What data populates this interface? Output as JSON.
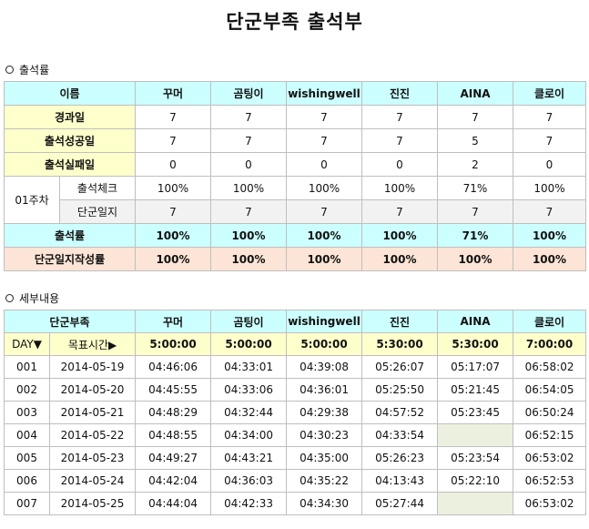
{
  "title": "단군부족 출석부",
  "section1": {
    "heading": "출석률",
    "header": [
      "이름",
      "꾸머",
      "곰팅이",
      "wishingwell",
      "진진",
      "AINA",
      "클로이"
    ],
    "rows": [
      {
        "label": "경과일",
        "values": [
          "7",
          "7",
          "7",
          "7",
          "7",
          "7"
        ]
      },
      {
        "label": "출석성공일",
        "values": [
          "7",
          "7",
          "7",
          "7",
          "5",
          "7"
        ]
      },
      {
        "label": "출석실패일",
        "values": [
          "0",
          "0",
          "0",
          "0",
          "2",
          "0"
        ]
      }
    ],
    "week_label": "01주차",
    "week_rows": [
      {
        "label": "출석체크",
        "values": [
          "100%",
          "100%",
          "100%",
          "100%",
          "71%",
          "100%"
        ]
      },
      {
        "label": "단군일지",
        "values": [
          "7",
          "7",
          "7",
          "7",
          "7",
          "7"
        ]
      }
    ],
    "rate_row": {
      "label": "출석률",
      "values": [
        "100%",
        "100%",
        "100%",
        "100%",
        "71%",
        "100%"
      ]
    },
    "journal_row": {
      "label": "단군일지작성률",
      "values": [
        "100%",
        "100%",
        "100%",
        "100%",
        "100%",
        "100%"
      ]
    }
  },
  "section2": {
    "heading": "세부내용",
    "header": [
      "단군부족",
      "꾸머",
      "곰팅이",
      "wishingwell",
      "진진",
      "AINA",
      "클로이"
    ],
    "day_label": "DAY▼",
    "target_label": "목표시간▶",
    "targets": [
      "5:00:00",
      "5:00:00",
      "5:00:00",
      "5:30:00",
      "5:30:00",
      "7:00:00"
    ],
    "rows": [
      {
        "day": "001",
        "date": "2014-05-19",
        "times": [
          "04:46:06",
          "04:33:01",
          "04:39:08",
          "05:26:07",
          "05:17:07",
          "06:58:02"
        ]
      },
      {
        "day": "002",
        "date": "2014-05-20",
        "times": [
          "04:45:55",
          "04:33:06",
          "04:36:01",
          "05:25:50",
          "05:21:45",
          "06:54:05"
        ]
      },
      {
        "day": "003",
        "date": "2014-05-21",
        "times": [
          "04:48:29",
          "04:32:44",
          "04:29:38",
          "04:57:52",
          "05:23:45",
          "06:50:24"
        ]
      },
      {
        "day": "004",
        "date": "2014-05-22",
        "times": [
          "04:48:55",
          "04:34:00",
          "04:30:23",
          "04:33:54",
          "",
          "06:52:15"
        ]
      },
      {
        "day": "005",
        "date": "2014-05-23",
        "times": [
          "04:49:27",
          "04:43:21",
          "04:35:00",
          "05:26:23",
          "05:23:54",
          "06:53:02"
        ]
      },
      {
        "day": "006",
        "date": "2014-05-24",
        "times": [
          "04:42:04",
          "04:36:03",
          "04:35:22",
          "04:13:43",
          "05:22:10",
          "06:52:53"
        ]
      },
      {
        "day": "007",
        "date": "2014-05-25",
        "times": [
          "04:44:04",
          "04:42:33",
          "04:34:30",
          "05:27:44",
          "",
          "06:53:02"
        ]
      }
    ]
  },
  "colors": {
    "header_bg": "#ccffff",
    "yellow_bg": "#ffffcc",
    "peach_bg": "#fce4d6",
    "missing_bg": "#ebf1de",
    "grid": "#bfbfbf"
  }
}
